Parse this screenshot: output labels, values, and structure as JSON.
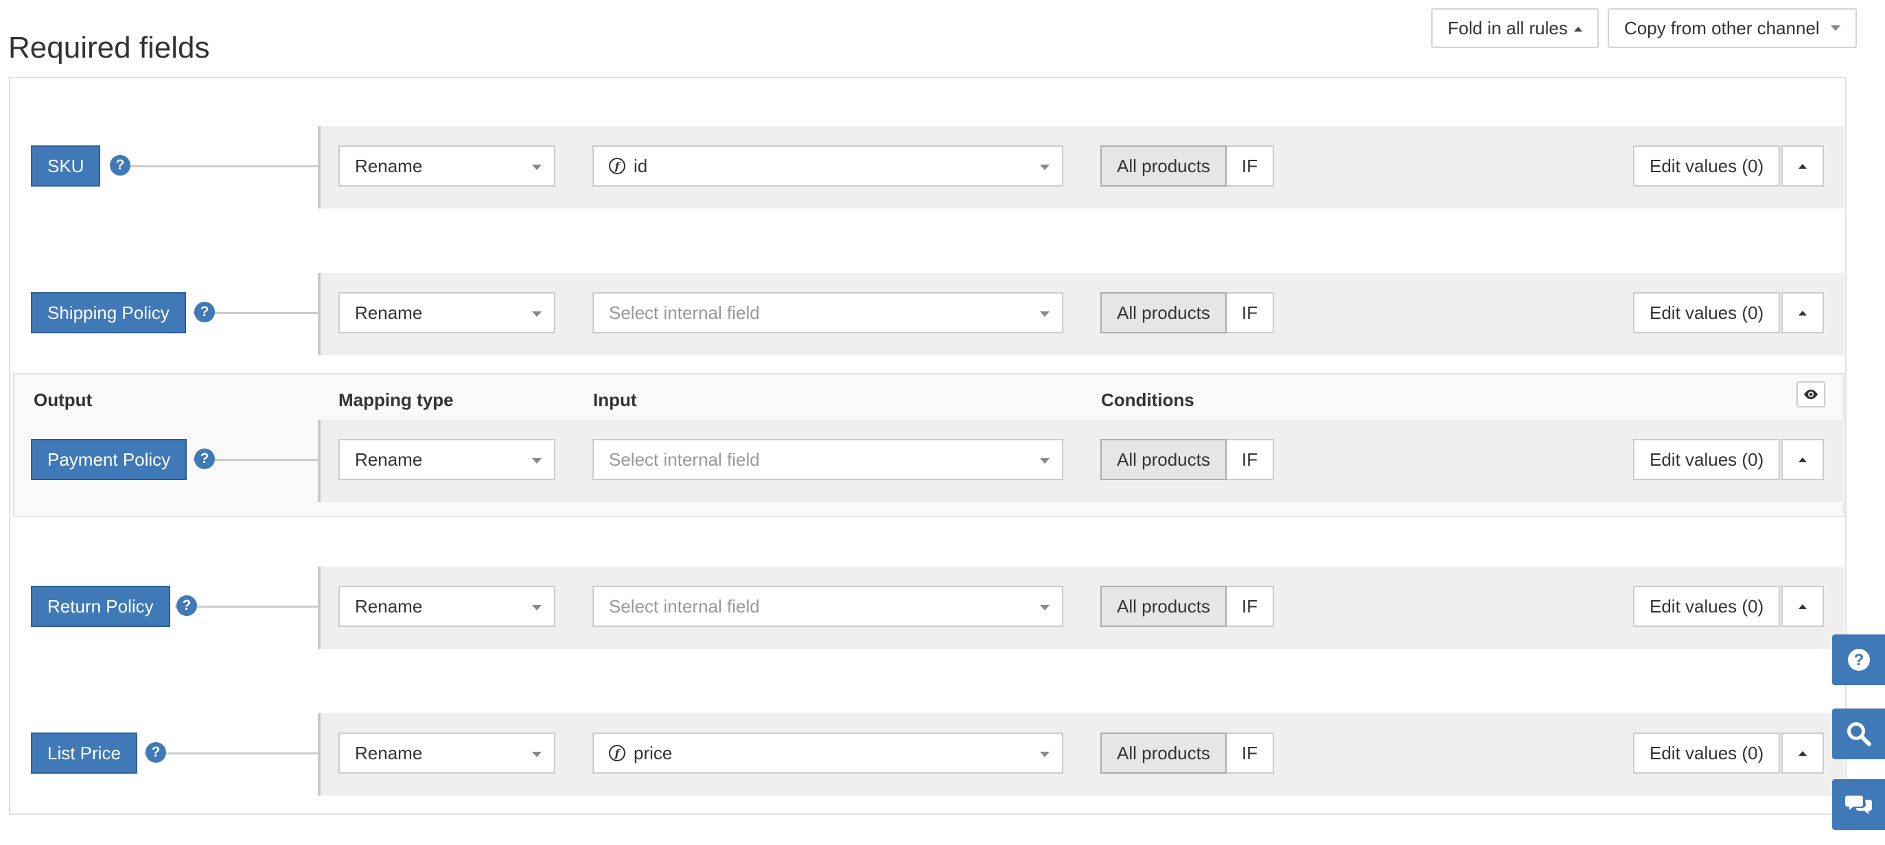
{
  "page": {
    "title": "Required fields"
  },
  "toolbar": {
    "fold_label": "Fold in all rules",
    "copy_label": "Copy from other channel"
  },
  "columns": {
    "output": "Output",
    "mapping_type": "Mapping type",
    "input": "Input",
    "conditions": "Conditions"
  },
  "rules": [
    {
      "output": "SKU",
      "mapping": "Rename",
      "input": "id",
      "input_is_field": true,
      "condition_all": "All products",
      "condition_if": "IF",
      "edit_label": "Edit values (0)"
    },
    {
      "output": "Shipping Policy",
      "mapping": "Rename",
      "input": "Select internal field",
      "input_is_field": false,
      "condition_all": "All products",
      "condition_if": "IF",
      "edit_label": "Edit values (0)"
    },
    {
      "output": "Payment Policy",
      "mapping": "Rename",
      "input": "Select internal field",
      "input_is_field": false,
      "condition_all": "All products",
      "condition_if": "IF",
      "edit_label": "Edit values (0)"
    },
    {
      "output": "Return Policy",
      "mapping": "Rename",
      "input": "Select internal field",
      "input_is_field": false,
      "condition_all": "All products",
      "condition_if": "IF",
      "edit_label": "Edit values (0)"
    },
    {
      "output": "List Price",
      "mapping": "Rename",
      "input": "price",
      "input_is_field": true,
      "condition_all": "All products",
      "condition_if": "IF",
      "edit_label": "Edit values (0)"
    }
  ],
  "side_actions": [
    "help-icon",
    "search-icon",
    "chat-icon"
  ],
  "colors": {
    "primary": "#3f79b7",
    "row_bg": "#efefef",
    "border": "#cccccc"
  }
}
